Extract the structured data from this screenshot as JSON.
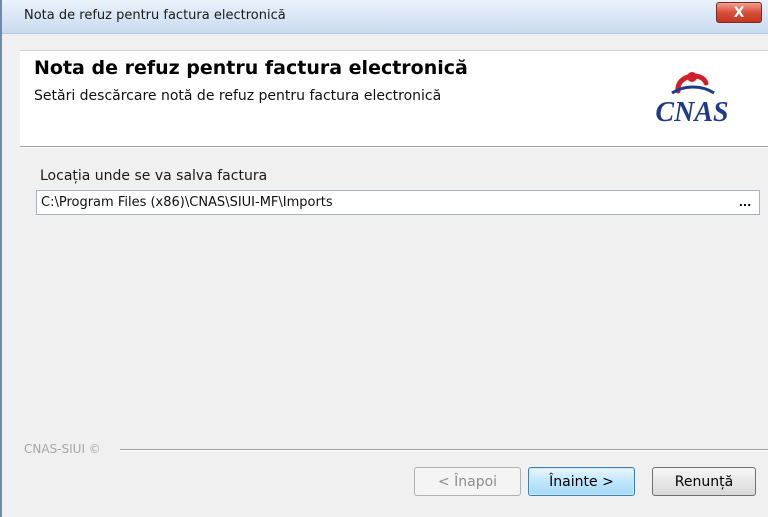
{
  "window": {
    "title": "Nota de refuz pentru factura electronică",
    "close_label": "X"
  },
  "header": {
    "title": "Nota de refuz pentru factura electronică",
    "subtitle": "Setări descărcare notă de refuz pentru factura electronică",
    "logo_text": "CNAS"
  },
  "form": {
    "location_label": "Locația unde se va salva factura",
    "location_value": "C:\\Program Files (x86)\\CNAS\\SIUI-MF\\Imports",
    "browse_label": "..."
  },
  "footer": {
    "brand": "CNAS-SIUI ©"
  },
  "buttons": {
    "back_label": "< Înapoi",
    "next_label": "Înainte >",
    "cancel_label": "Renunță"
  },
  "colors": {
    "logo_blue": "#1f3a8a",
    "logo_red": "#d0202a",
    "close_red": "#c2361f",
    "default_button_border": "#3c7fb1"
  }
}
